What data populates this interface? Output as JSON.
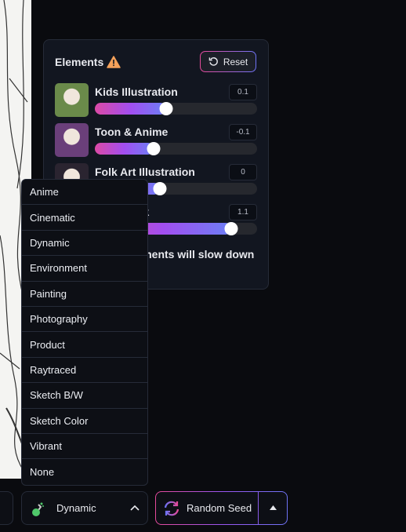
{
  "panel": {
    "title": "Elements",
    "warning_icon": "warning-triangle-icon",
    "reset_label": "Reset",
    "slider_range": [
      -1,
      1.5
    ],
    "elements": [
      {
        "name": "Kids Illustration",
        "value": "0.1",
        "level": 0.1,
        "thumb": "#6a8a4a"
      },
      {
        "name": "Toon & Anime",
        "value": "-0.1",
        "level": -0.1,
        "thumb": "#6a3f7a"
      },
      {
        "name": "Folk Art Illustration",
        "value": "0",
        "level": 0,
        "thumb": "#2a2430"
      },
      {
        "name": "Storybook",
        "value": "1.1",
        "level": 1.1,
        "thumb": "#3a3040"
      }
    ],
    "note": "Adding more Elements will slow down generation times"
  },
  "dropdown": {
    "options": [
      "Anime",
      "Cinematic",
      "Dynamic",
      "Environment",
      "Painting",
      "Photography",
      "Product",
      "Raytraced",
      "Sketch B/W",
      "Sketch Color",
      "Vibrant",
      "None"
    ]
  },
  "bottom": {
    "style_label": "Dynamic",
    "seed_label": "Random Seed"
  },
  "colors": {
    "accent_pink": "#e54a9a",
    "accent_blue": "#6e73f5",
    "warning": "#f5a15a"
  }
}
